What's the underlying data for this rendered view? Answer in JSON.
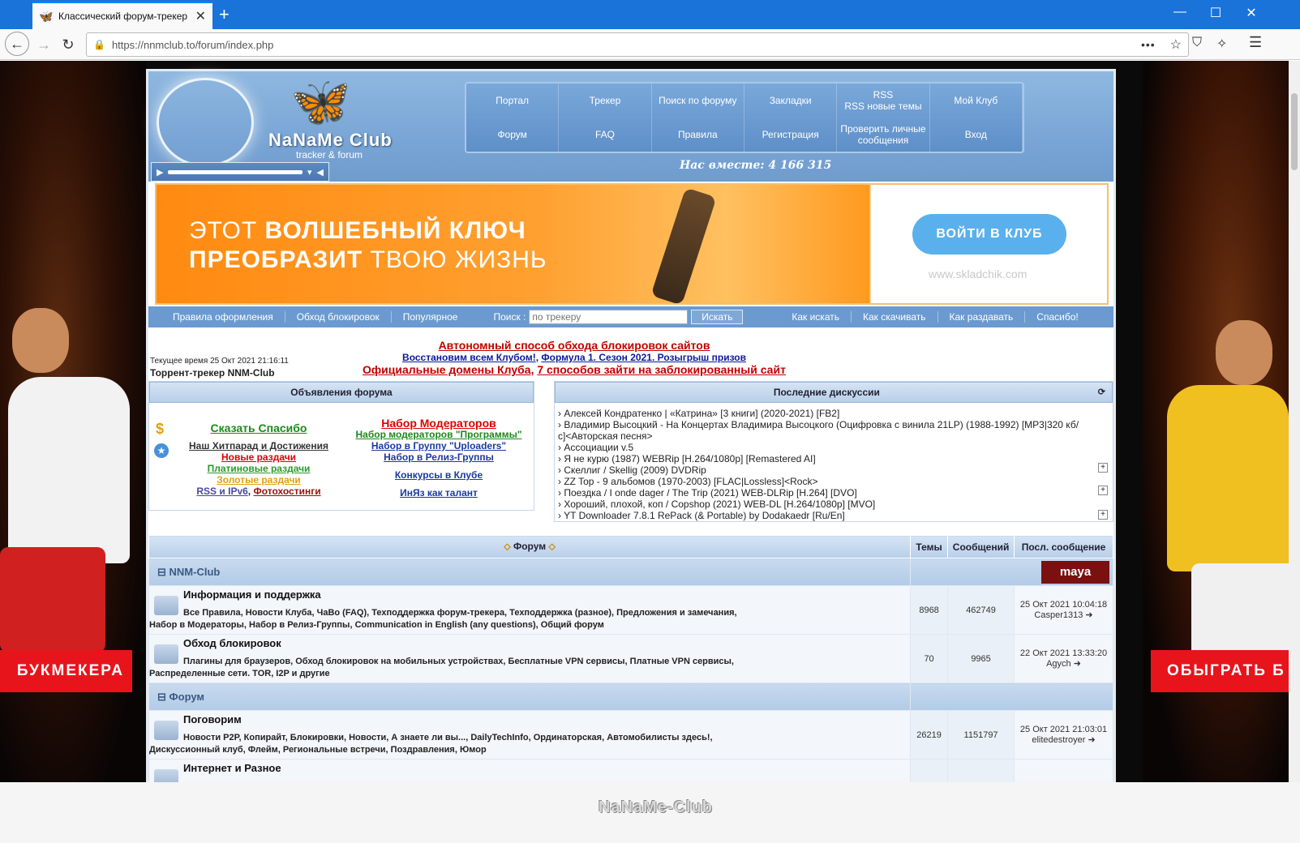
{
  "browser": {
    "tab_title": "Классический форум-трекер",
    "url": "https://nnmclub.to/forum/index.php",
    "new_tab": "+",
    "more": "•••"
  },
  "header": {
    "logo_text": "NaNaMe Club",
    "logo_sub": "tracker & forum",
    "together": "Нас вместе: 4 166 315",
    "nav": [
      "Портал",
      "Трекер",
      "Поиск по форуму",
      "Закладки",
      "RSS\nRSS новые темы",
      "Мой Клуб",
      "Форум",
      "FAQ",
      "Правила",
      "Регистрация",
      "Проверить личные сообщения",
      "Вход"
    ]
  },
  "banner": {
    "line1_light": "ЭТОТ ",
    "line1_bold": "ВОЛШЕБНЫЙ КЛЮЧ",
    "line2_bold": "ПРЕОБРАЗИТ ",
    "line2_light": "ТВОЮ ЖИЗНЬ",
    "cta": "ВОЙТИ В КЛУБ",
    "site": "www.skladchik.com"
  },
  "subnav": {
    "left": [
      "Правила оформления",
      "Обход блокировок",
      "Популярное"
    ],
    "search_label": "Поиск :",
    "search_placeholder": "по трекеру",
    "search_button": "Искать",
    "right": [
      "Как искать",
      "Как скачивать",
      "Как раздавать",
      "Спасибо!"
    ]
  },
  "info": {
    "time": "Текущее время 25 Окт 2021 21:16:11",
    "tracker": "Торрент-трекер NNM-Club",
    "a1": "Автономный способ обхода блокировок сайтов",
    "a2a": "Восстановим всем Клубом!",
    "a2b": "Формула 1. Сезон 2021. Розыгрыш призов",
    "a3a": "Официальные домены Клуба",
    "a3b": "7 способов зайти на заблокированный сайт"
  },
  "news": {
    "title": "Объявления форума",
    "left": {
      "thanks": "Сказать Спасибо",
      "hit": "Наш Хитпарад и Достижения",
      "new": "Новые раздачи",
      "platinum": "Платиновые раздачи",
      "gold": "Золотые раздачи",
      "rss": "RSS и IPv6",
      "photo": "Фотохостинги"
    },
    "right": {
      "mods": "Набор Модераторов",
      "mods_prog": "Набор модераторов \"Программы\"",
      "uploaders": "Набор в Группу \"Uploaders\"",
      "release": "Набор в Релиз-Группы",
      "contests": "Конкурсы в Клубе",
      "lang": "ИнЯз как талант"
    }
  },
  "recent": {
    "title": "Последние дискуссии",
    "items": [
      "Алексей Кондратенко | «Катрина» [3 книги] (2020-2021) [FB2]",
      "Владимир Высоцкий - На Концертах Владимира Высоцкого (Оцифровка с винила 21LP) (1988-1992) [MP3|320 кб/с]<Авторская песня>",
      "Ассоциации v.5",
      "Я не курю (1987) WEBRip [H.264/1080p] [Remastered AI]",
      "Скеллиг / Skellig (2009) DVDRip",
      "ZZ Top - 9 альбомов (1970-2003) [FLAC|Lossless]<Rock>",
      "Поездка / I onde dager / The Trip (2021) WEB-DLRip [H.264] [DVO]",
      "Хороший, плохой, коп / Copshop (2021) WEB-DL [H.264/1080p] [MVO]",
      "YT Downloader 7.8.1 RePack (& Portable) by Dodakaedr [Ru/En]"
    ]
  },
  "table": {
    "headers": [
      "Форум",
      "Темы",
      "Сообщений",
      "Посл. сообщение"
    ],
    "cat1": "NNM-Club",
    "cat1_badge": "maya",
    "cat2": "Форум",
    "rows": [
      {
        "name": "Информация и поддержка",
        "subs1": "Все Правила,  Новости Клуба,  ЧаВо (FAQ),  Техподдержка форум-трекера,  Техподдержка (разное),  Предложения и замечания,",
        "subs2": "Набор в Модераторы,  Набор в Релиз-Группы,  Communication in English (any questions),  Общий форум",
        "topics": "8968",
        "posts": "462749",
        "last_date": "25 Окт 2021 10:04:18",
        "last_user": "Casper1313"
      },
      {
        "name": "Обход блокировок",
        "subs1": "Плагины для браузеров,  Обход блокировок на мобильных устройствах,  Бесплатные VPN сервисы,  Платные VPN сервисы,",
        "subs2": "Распределенные сети. TOR, I2P и другие",
        "topics": "70",
        "posts": "9965",
        "last_date": "22 Окт 2021 13:33:20",
        "last_user": "Agych"
      },
      {
        "name": "Поговорим",
        "subs1": "Новости P2P, Копирайт, Блокировки,  Новости,  А знаете ли вы...,  DailyTechInfo,  Ординаторская,  Автомобилисты здесь!,",
        "subs2": "Дискуссионный клуб,  Флейм,  Региональные встречи,  Поздравления,  Юмор",
        "topics": "26219",
        "posts": "1151797",
        "last_date": "25 Окт 2021 21:03:01",
        "last_user": "elitedestroyer"
      },
      {
        "name": "Интернет и Разное"
      }
    ]
  },
  "ads": {
    "left_text": "БУКМЕКЕРА",
    "right_text": "ОБЫГРАТЬ Б"
  },
  "footer": {
    "logo": "NaNaMe-Club"
  }
}
